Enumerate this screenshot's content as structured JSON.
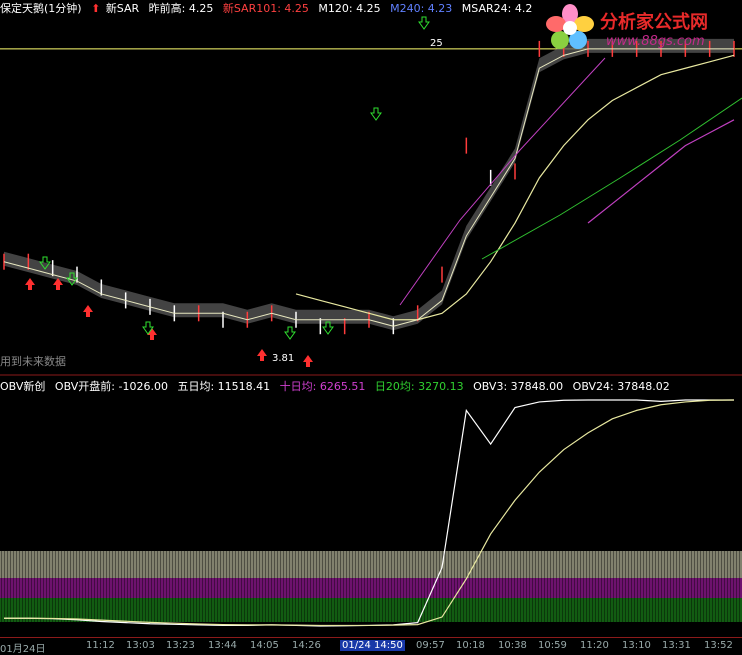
{
  "top_header": {
    "title": "保定天鹅(1分钟)",
    "sar_label": "新SAR",
    "prev_high_label": "昨前高: 4.25",
    "newsar_label": "新SAR101: 4.25",
    "m120_label": "M120: 4.25",
    "m240_label": "M240: 4.23",
    "msar_label": "MSAR24: 4.2"
  },
  "obv_header": {
    "name": "OBV新创",
    "pre_open": "OBV开盘前: -1026.00",
    "five_day": "五日均: 11518.41",
    "ten_day": "十日均: 6265.51",
    "twenty_day": "日20均: 3270.13",
    "obv3": "OBV3: 37848.00",
    "obv24": "OBV24: 37848.02"
  },
  "annotations": {
    "future_note": "用到未来数据",
    "low_label": "3.81",
    "high_label": "25"
  },
  "logo": {
    "text": "分析家公式网",
    "url": "www.88gs.com"
  },
  "x_axis": {
    "ticks": [
      "01月24日",
      "11:12",
      "13:03",
      "13:23",
      "13:44",
      "14:05",
      "14:26",
      "01/24 14:50",
      "09:57",
      "10:18",
      "10:38",
      "10:59",
      "11:20",
      "13:10",
      "13:31",
      "13:52"
    ],
    "selected": "01/24 14:50"
  },
  "colors": {
    "background": "#000000",
    "price_up": "#ff3c3c",
    "price_down": "#ffffff",
    "ma_yellow": "#e8e8a0",
    "ma_magenta": "#c040c0",
    "ma_green": "#30c030",
    "band_gray": "#5a5a5a",
    "header_red": "#ff4040",
    "header_yellow": "#ffff50",
    "header_blue": "#6080ff",
    "obv_line": "#ffffff",
    "vol_white": "#e0e0c0",
    "vol_magenta": "#c020c0",
    "vol_green": "#20a020",
    "arrow_up": "#ff3030",
    "arrow_down": "#30e030"
  },
  "chart_data": [
    {
      "type": "line",
      "title": "保定天鹅(1分钟)",
      "ylim": [
        3.78,
        4.27
      ],
      "series": [
        {
          "name": "新SAR101",
          "values": [
            3.92,
            3.92,
            3.91,
            3.9,
            3.88,
            3.86,
            3.85,
            3.84,
            3.84,
            3.83,
            3.83,
            3.84,
            3.83,
            3.82,
            3.82,
            3.83,
            3.82,
            3.84,
            3.9,
            4.1,
            4.05,
            4.06,
            4.25,
            4.25,
            4.25,
            4.25,
            4.25,
            4.25,
            4.25,
            4.25,
            4.25
          ]
        },
        {
          "name": "M120",
          "values": [
            null,
            null,
            null,
            null,
            null,
            null,
            null,
            null,
            null,
            null,
            null,
            null,
            3.87,
            3.86,
            3.85,
            3.84,
            3.83,
            3.83,
            3.84,
            3.87,
            3.92,
            3.98,
            4.05,
            4.1,
            4.14,
            4.17,
            4.19,
            4.21,
            4.22,
            4.23,
            4.24
          ]
        },
        {
          "name": "M240",
          "values": [
            null,
            null,
            null,
            null,
            null,
            null,
            null,
            null,
            null,
            null,
            null,
            null,
            null,
            null,
            null,
            null,
            null,
            null,
            null,
            null,
            null,
            null,
            null,
            null,
            3.98,
            4.01,
            4.04,
            4.07,
            4.1,
            4.12,
            4.14
          ]
        },
        {
          "name": "MSAR24",
          "values": [
            3.92,
            3.91,
            3.9,
            3.89,
            3.87,
            3.86,
            3.85,
            3.84,
            3.84,
            3.84,
            3.83,
            3.84,
            3.83,
            3.83,
            3.83,
            3.83,
            3.82,
            3.83,
            3.86,
            3.96,
            4.02,
            4.08,
            4.22,
            4.24,
            4.25,
            4.25,
            4.25,
            4.25,
            4.25,
            4.25,
            4.25
          ]
        }
      ]
    },
    {
      "type": "line",
      "title": "OBV新创",
      "series": [
        {
          "name": "OBV3",
          "values": [
            -1026,
            -1026,
            -1100,
            -1300,
            -1600,
            -1800,
            -2000,
            -2100,
            -2200,
            -2300,
            -2300,
            -2200,
            -2300,
            -2400,
            -2350,
            -2300,
            -2200,
            -1800,
            8000,
            36000,
            30000,
            36500,
            37500,
            37800,
            37848,
            37848,
            37848,
            37600,
            37848,
            37848,
            37848
          ]
        },
        {
          "name": "OBV24",
          "values": [
            -1026,
            -1026,
            -1050,
            -1150,
            -1350,
            -1550,
            -1750,
            -1900,
            -2050,
            -2150,
            -2200,
            -2200,
            -2250,
            -2300,
            -2300,
            -2300,
            -2250,
            -2150,
            -800,
            6000,
            14000,
            20000,
            25000,
            29000,
            32000,
            34500,
            36000,
            37000,
            37500,
            37800,
            37848
          ]
        }
      ]
    }
  ]
}
